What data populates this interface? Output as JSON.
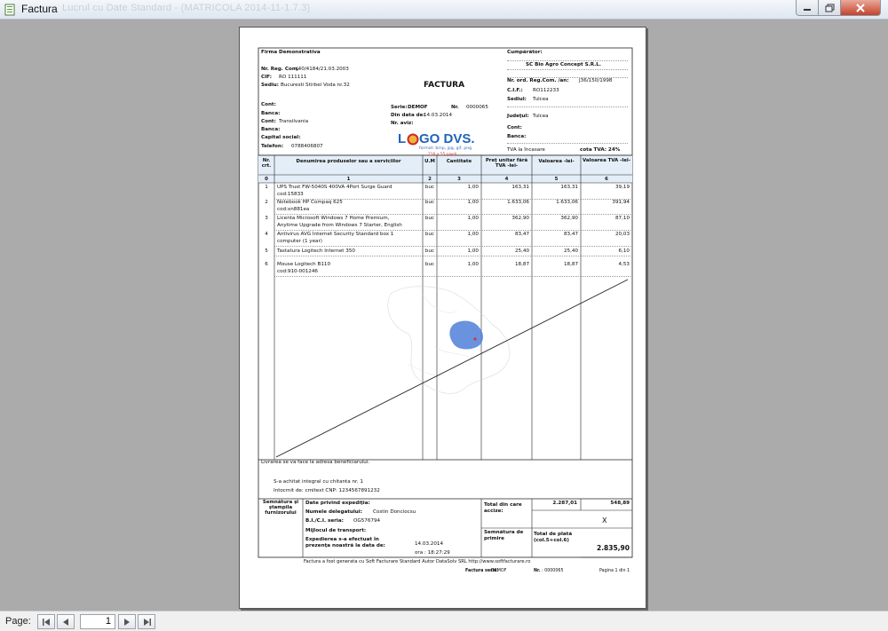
{
  "window": {
    "title": "Factura",
    "ghost_title": "Lucrul cu Date Standard - (MATRICOLA 2014-11-1.7.3)"
  },
  "bottom": {
    "page_label": "Page:",
    "page_value": "1"
  },
  "invoice": {
    "title": "FACTURA",
    "supplier": {
      "name": "Firma Demonstrativa",
      "reg_label": "Nr. Reg. Com.",
      "reg_value": "J40/4184/21.03.2003",
      "cif_label": "CIF:",
      "cif_value": "RO 111111",
      "sediu_label": "Sediu:",
      "sediu_value": "Bucuresti Stirbei Voda nr.32",
      "cont_label": "Cont:",
      "banca_label": "Banca:",
      "cont2_label": "Cont:",
      "cont2_value": "Transilvania",
      "banca2_label": "Banca:",
      "capital_label": "Capital social:",
      "telefon_label": "Telefon:",
      "telefon_value": "0788406807"
    },
    "doc": {
      "serie_label": "Serie:",
      "serie_value": "DEMOF",
      "nr_label": "Nr.",
      "nr_value": "0000065",
      "data_label": "Din data de:",
      "data_value": "14.03.2014",
      "aviz_label": "Nr. aviz:"
    },
    "logo": {
      "text_a": "L",
      "text_b": "GO DVS.",
      "sub": "format: bmp, jpg, gif, png",
      "size": "216 x 55 pixeli"
    },
    "buyer": {
      "label": "Cumpărător:",
      "name": "SC Bio Agro Concept S.R.L.",
      "reg_label": "Nr. ord. Reg.Com. /an:",
      "reg_value": "J36/150/1998",
      "cif_label": "C.I.F.:",
      "cif_value": "RO112233",
      "sediu_label": "Sediul:",
      "sediu_value": "Tulcea",
      "judet_label": "Judeţul:",
      "judet_value": "Tulcea",
      "cont_label": "Cont:",
      "banca_label": "Banca:"
    },
    "tva_note_left": "TVA la încasare",
    "tva_note_right": "cota TVA: 24%",
    "columns": {
      "nr": "Nr. crt.",
      "den": "Denumirea produselor sau a serviciilor",
      "um": "U.M",
      "cant": "Cantitate",
      "pret": "Preţ unitar fără TVA -lei-",
      "val": "Valoarea -lei-",
      "tva": "Valoarea TVA -lei-"
    },
    "col_index": [
      "0",
      "1",
      "2",
      "3",
      "4",
      "5",
      "6"
    ],
    "rows": [
      {
        "nr": "1",
        "den": "UPS Trust FW-5040S 400VA 4Port Surge Guard",
        "den2": "cod:15833",
        "um": "buc",
        "cant": "1,00",
        "pret": "163,31",
        "val": "163,31",
        "tva": "39,19"
      },
      {
        "nr": "2",
        "den": "Notebook HP Compaq 625",
        "den2": "cod:xn881ea",
        "um": "buc",
        "cant": "1,00",
        "pret": "1.633,06",
        "val": "1.633,06",
        "tva": "391,94"
      },
      {
        "nr": "3",
        "den": "Licenta Microsoft Windows 7 Home Premium,",
        "den2": "Anytime Upgrade from Windows 7 Starter, English",
        "um": "buc",
        "cant": "1,00",
        "pret": "362,90",
        "val": "362,90",
        "tva": "87,10"
      },
      {
        "nr": "4",
        "den": "Antivirus AVG Internet Security Standard box 1",
        "den2": "computer (1 year)",
        "um": "buc",
        "cant": "1,00",
        "pret": "83,47",
        "val": "83,47",
        "tva": "20,03"
      },
      {
        "nr": "5",
        "den": "Tastatura Logitech Internet 350",
        "den2": "",
        "um": "buc",
        "cant": "1,00",
        "pret": "25,40",
        "val": "25,40",
        "tva": "6,10"
      },
      {
        "nr": "6",
        "den": "Mouse Logitech B110",
        "den2": "cod:910-001246",
        "um": "buc",
        "cant": "1,00",
        "pret": "18,87",
        "val": "18,87",
        "tva": "4,53"
      }
    ],
    "notes": {
      "livrare": "Livrarea se va face la adresa beneficiarului.",
      "achitat": "S-a achitat integral cu chitanta nr. 1",
      "intocmit": "Intocmit de: cmitext  CNP: 1234567891232"
    },
    "footer": {
      "semnatura_furnizor": "Semnătura şi ştampila furnizorului",
      "exp_title": "Date privind expediţia:",
      "delegat_label": "Numele delegatului:",
      "delegat_value": "Costin Donciocsu",
      "bi_label": "B.I./C.I. seria:",
      "bi_value": "OG576794",
      "transport_label": "Mijlocul de transport:",
      "expedierea_label": "Expedierea s-a efectuat în prezenţa noastră la data de:",
      "exp_date": "14.03.2014",
      "exp_ora": "ora : 18:27:29",
      "total_label": "Total din care accize:",
      "total_val": "2.287,01",
      "total_tva": "548,89",
      "accize_x": "X",
      "semnatura_primire": "Semnătura de primire",
      "total_plata_label": "Total de plată (col.5+col.6)",
      "total_plata_val": "2.835,90",
      "generata": "Factura a fost generata cu Soft Facturare Standard Autor DataSolv SRL http://www.softfacturare.ro",
      "factura_seria_label": "Factura seria:",
      "factura_seria_value": "DEMOF",
      "nr_label": "Nr.",
      "nr_value": ": 0000065",
      "pagina": "Pagina 1 din 1"
    }
  }
}
